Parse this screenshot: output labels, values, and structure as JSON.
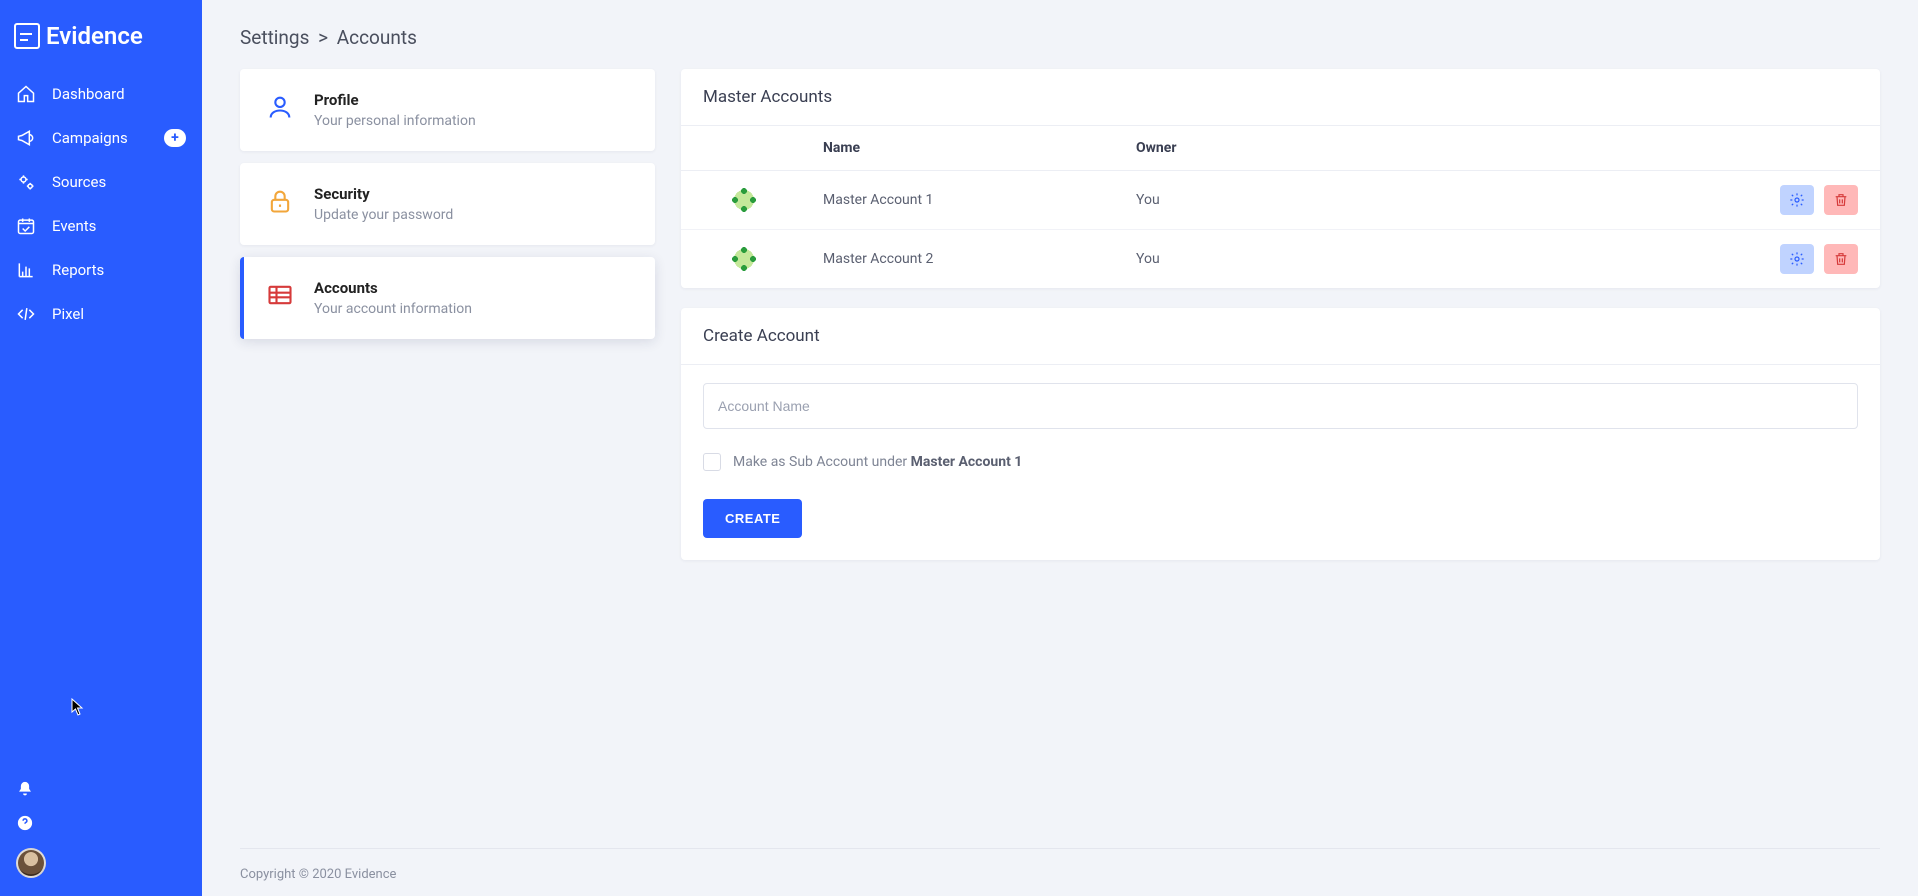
{
  "app_name": "Evidence",
  "sidebar": {
    "items": [
      {
        "label": "Dashboard",
        "icon": "home-icon"
      },
      {
        "label": "Campaigns",
        "icon": "megaphone-icon",
        "has_plus": true
      },
      {
        "label": "Sources",
        "icon": "cogs-icon"
      },
      {
        "label": "Events",
        "icon": "calendar-check-icon"
      },
      {
        "label": "Reports",
        "icon": "chart-bar-icon"
      },
      {
        "label": "Pixel",
        "icon": "code-icon"
      }
    ]
  },
  "breadcrumb": {
    "parent": "Settings",
    "current": "Accounts"
  },
  "settings_nav": [
    {
      "title": "Profile",
      "subtitle": "Your personal information",
      "icon": "user-icon",
      "color": "#295cff",
      "active": false
    },
    {
      "title": "Security",
      "subtitle": "Update your password",
      "icon": "lock-icon",
      "color": "#f2a63a",
      "active": false
    },
    {
      "title": "Accounts",
      "subtitle": "Your account information",
      "icon": "table-icon",
      "color": "#d63a3a",
      "active": true
    }
  ],
  "master_accounts": {
    "title": "Master Accounts",
    "columns": {
      "name": "Name",
      "owner": "Owner"
    },
    "rows": [
      {
        "name": "Master Account 1",
        "owner": "You"
      },
      {
        "name": "Master Account 2",
        "owner": "You"
      }
    ]
  },
  "create_account": {
    "title": "Create Account",
    "placeholder": "Account Name",
    "sub_label_prefix": "Make as Sub Account under ",
    "sub_label_master": "Master Account 1",
    "button": "CREATE"
  },
  "footer": "Copyright © 2020 Evidence"
}
